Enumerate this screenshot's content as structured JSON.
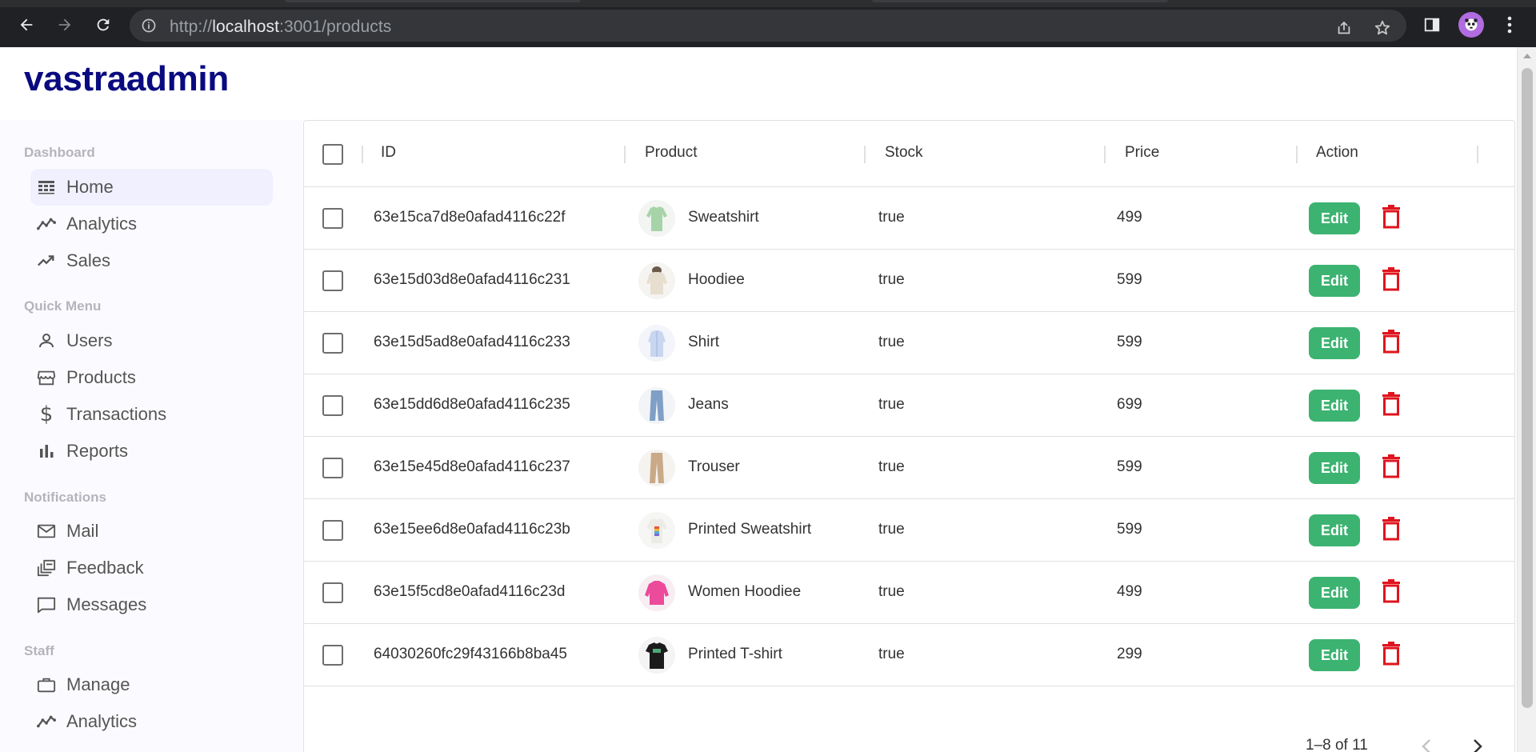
{
  "browser": {
    "url_scheme": "http://",
    "url_host": "localhost",
    "url_path": ":3001/products"
  },
  "app": {
    "logo": "vastraadmin"
  },
  "sidebar": {
    "sections": [
      {
        "title": "Dashboard",
        "items": [
          {
            "label": "Home",
            "icon": "dashboard-icon",
            "active": true
          },
          {
            "label": "Analytics",
            "icon": "line-chart-icon"
          },
          {
            "label": "Sales",
            "icon": "trending-up-icon"
          }
        ]
      },
      {
        "title": "Quick Menu",
        "items": [
          {
            "label": "Users",
            "icon": "user-icon"
          },
          {
            "label": "Products",
            "icon": "storefront-icon"
          },
          {
            "label": "Transactions",
            "icon": "dollar-icon"
          },
          {
            "label": "Reports",
            "icon": "bar-chart-icon"
          }
        ]
      },
      {
        "title": "Notifications",
        "items": [
          {
            "label": "Mail",
            "icon": "mail-icon"
          },
          {
            "label": "Feedback",
            "icon": "dynamic-feed-icon"
          },
          {
            "label": "Messages",
            "icon": "chat-bubble-icon"
          }
        ]
      },
      {
        "title": "Staff",
        "items": [
          {
            "label": "Manage",
            "icon": "briefcase-icon"
          },
          {
            "label": "Analytics",
            "icon": "line-chart-icon"
          }
        ]
      }
    ]
  },
  "table": {
    "columns": [
      "ID",
      "Product",
      "Stock",
      "Price",
      "Action"
    ],
    "rows": [
      {
        "id": "63e15ca7d8e0afad4116c22f",
        "product": "Sweatshirt",
        "stock": "true",
        "price": "499",
        "image": "green-sweatshirt"
      },
      {
        "id": "63e15d03d8e0afad4116c231",
        "product": "Hoodiee",
        "stock": "true",
        "price": "599",
        "image": "beige-hoodie"
      },
      {
        "id": "63e15d5ad8e0afad4116c233",
        "product": "Shirt",
        "stock": "true",
        "price": "599",
        "image": "blue-shirt"
      },
      {
        "id": "63e15dd6d8e0afad4116c235",
        "product": "Jeans",
        "stock": "true",
        "price": "699",
        "image": "blue-jeans"
      },
      {
        "id": "63e15e45d8e0afad4116c237",
        "product": "Trouser",
        "stock": "true",
        "price": "599",
        "image": "khaki-trouser"
      },
      {
        "id": "63e15ee6d8e0afad4116c23b",
        "product": "Printed Sweatshirt",
        "stock": "true",
        "price": "599",
        "image": "printed-sweatshirt"
      },
      {
        "id": "63e15f5cd8e0afad4116c23d",
        "product": "Women Hoodiee",
        "stock": "true",
        "price": "499",
        "image": "pink-hoodie"
      },
      {
        "id": "64030260fc29f43166b8ba45",
        "product": "Printed T-shirt",
        "stock": "true",
        "price": "299",
        "image": "black-tshirt"
      }
    ],
    "edit_label": "Edit",
    "pagination": "1–8 of 11"
  },
  "colors": {
    "accent_green": "#3cb371",
    "delete_red": "#e0141e",
    "logo_navy": "#0a0a80"
  }
}
